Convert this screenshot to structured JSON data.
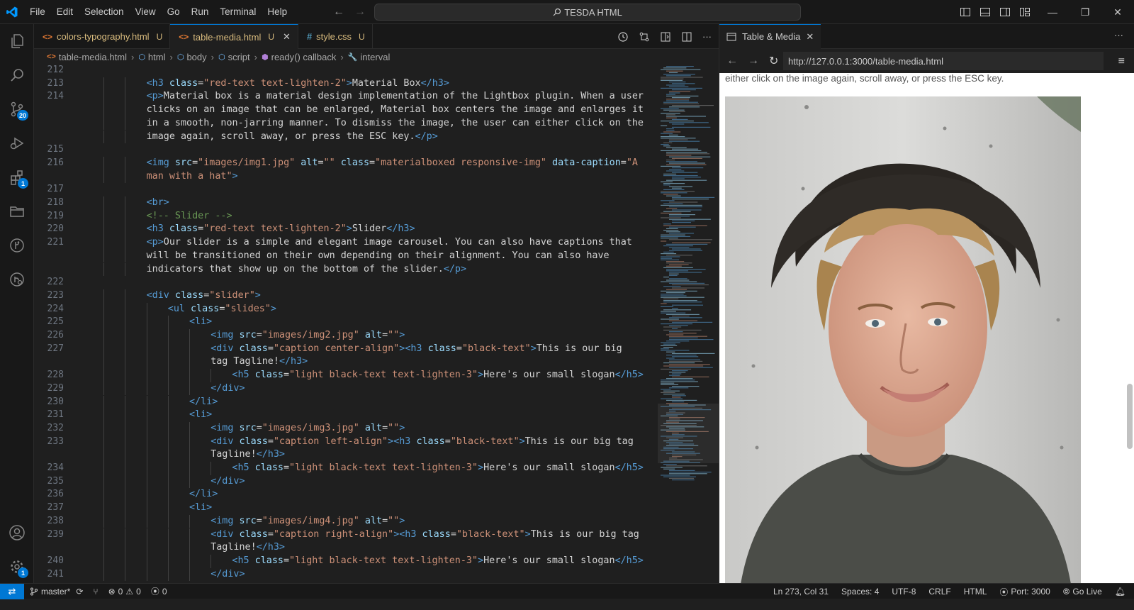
{
  "titlebar": {
    "menu": [
      "File",
      "Edit",
      "Selection",
      "View",
      "Go",
      "Run",
      "Terminal",
      "Help"
    ],
    "command_center": "TESDA HTML"
  },
  "activity_bar": {
    "items": [
      {
        "icon": "files-icon"
      },
      {
        "icon": "search-icon"
      },
      {
        "icon": "source-control-icon",
        "badge": "20"
      },
      {
        "icon": "run-debug-icon"
      },
      {
        "icon": "extensions-icon",
        "badge": "1"
      },
      {
        "icon": "folder-icon"
      },
      {
        "icon": "git-graph-icon"
      },
      {
        "icon": "remote-explorer-icon"
      }
    ],
    "bottom": [
      {
        "icon": "account-icon"
      },
      {
        "icon": "settings-gear-icon",
        "badge": "1"
      }
    ]
  },
  "editor_tabs": [
    {
      "label": "colors-typography.html",
      "modified": "U",
      "icon": "html-icon",
      "active": false
    },
    {
      "label": "table-media.html",
      "modified": "U",
      "icon": "html-icon",
      "active": true
    },
    {
      "label": "style.css",
      "modified": "U",
      "icon": "css-icon",
      "active": false
    }
  ],
  "breadcrumbs": [
    "table-media.html",
    "html",
    "body",
    "script",
    "ready() callback",
    "interval"
  ],
  "code_lines": [
    {
      "n": "212",
      "indent": 0,
      "parts": []
    },
    {
      "n": "213",
      "indent": 3,
      "parts": [
        [
          "t",
          "<h3 "
        ],
        [
          "a",
          "class"
        ],
        [
          "x",
          "="
        ],
        [
          "s",
          "\"red-text text-lighten-2\""
        ],
        [
          "t",
          ">"
        ],
        [
          "x",
          "Material Box"
        ],
        [
          "t",
          "</h3>"
        ]
      ]
    },
    {
      "n": "214",
      "indent": 3,
      "parts": [
        [
          "t",
          "<p>"
        ],
        [
          "x",
          "Material box is a material design implementation of the Lightbox plugin. When a user"
        ]
      ]
    },
    {
      "n": "",
      "indent": 3,
      "parts": [
        [
          "x",
          "clicks on an image that can be enlarged, Material box centers the image and enlarges it"
        ]
      ]
    },
    {
      "n": "",
      "indent": 3,
      "parts": [
        [
          "x",
          "in a smooth, non-jarring manner. To dismiss the image, the user can either click on the"
        ]
      ]
    },
    {
      "n": "",
      "indent": 3,
      "parts": [
        [
          "x",
          "image again, scroll away, or press the ESC key."
        ],
        [
          "t",
          "</p>"
        ]
      ]
    },
    {
      "n": "215",
      "indent": 0,
      "parts": []
    },
    {
      "n": "216",
      "indent": 3,
      "parts": [
        [
          "t",
          "<img "
        ],
        [
          "a",
          "src"
        ],
        [
          "x",
          "="
        ],
        [
          "s",
          "\"images/img1.jpg\""
        ],
        [
          "x",
          " "
        ],
        [
          "a",
          "alt"
        ],
        [
          "x",
          "="
        ],
        [
          "s",
          "\"\""
        ],
        [
          "x",
          " "
        ],
        [
          "a",
          "class"
        ],
        [
          "x",
          "="
        ],
        [
          "s",
          "\"materialboxed responsive-img\""
        ],
        [
          "x",
          " "
        ],
        [
          "a",
          "data-caption"
        ],
        [
          "x",
          "="
        ],
        [
          "s",
          "\"A"
        ]
      ]
    },
    {
      "n": "",
      "indent": 3,
      "parts": [
        [
          "s",
          "man with a hat\""
        ],
        [
          "t",
          ">"
        ]
      ]
    },
    {
      "n": "217",
      "indent": 0,
      "parts": []
    },
    {
      "n": "218",
      "indent": 3,
      "parts": [
        [
          "t",
          "<br>"
        ]
      ]
    },
    {
      "n": "219",
      "indent": 3,
      "parts": [
        [
          "c",
          "<!-- Slider -->"
        ]
      ]
    },
    {
      "n": "220",
      "indent": 3,
      "parts": [
        [
          "t",
          "<h3 "
        ],
        [
          "a",
          "class"
        ],
        [
          "x",
          "="
        ],
        [
          "s",
          "\"red-text text-lighten-2\""
        ],
        [
          "t",
          ">"
        ],
        [
          "x",
          "Slider"
        ],
        [
          "t",
          "</h3>"
        ]
      ]
    },
    {
      "n": "221",
      "indent": 3,
      "parts": [
        [
          "t",
          "<p>"
        ],
        [
          "x",
          "Our slider is a simple and elegant image carousel. You can also have captions that"
        ]
      ]
    },
    {
      "n": "",
      "indent": 3,
      "parts": [
        [
          "x",
          "will be transitioned on their own depending on their alignment. You can also have"
        ]
      ]
    },
    {
      "n": "",
      "indent": 3,
      "parts": [
        [
          "x",
          "indicators that show up on the bottom of the slider."
        ],
        [
          "t",
          "</p>"
        ]
      ]
    },
    {
      "n": "222",
      "indent": 0,
      "parts": []
    },
    {
      "n": "223",
      "indent": 3,
      "parts": [
        [
          "t",
          "<div "
        ],
        [
          "a",
          "class"
        ],
        [
          "x",
          "="
        ],
        [
          "s",
          "\"slider\""
        ],
        [
          "t",
          ">"
        ]
      ]
    },
    {
      "n": "224",
      "indent": 4,
      "parts": [
        [
          "t",
          "<ul "
        ],
        [
          "a",
          "class"
        ],
        [
          "x",
          "="
        ],
        [
          "s",
          "\"slides\""
        ],
        [
          "t",
          ">"
        ]
      ]
    },
    {
      "n": "225",
      "indent": 5,
      "parts": [
        [
          "t",
          "<li>"
        ]
      ]
    },
    {
      "n": "226",
      "indent": 6,
      "parts": [
        [
          "t",
          "<img "
        ],
        [
          "a",
          "src"
        ],
        [
          "x",
          "="
        ],
        [
          "s",
          "\"images/img2.jpg\""
        ],
        [
          "x",
          " "
        ],
        [
          "a",
          "alt"
        ],
        [
          "x",
          "="
        ],
        [
          "s",
          "\"\""
        ],
        [
          "t",
          ">"
        ]
      ]
    },
    {
      "n": "227",
      "indent": 6,
      "parts": [
        [
          "t",
          "<div "
        ],
        [
          "a",
          "class"
        ],
        [
          "x",
          "="
        ],
        [
          "s",
          "\"caption center-align\""
        ],
        [
          "t",
          ">"
        ],
        [
          "t",
          "<h3 "
        ],
        [
          "a",
          "class"
        ],
        [
          "x",
          "="
        ],
        [
          "s",
          "\"black-text\""
        ],
        [
          "t",
          ">"
        ],
        [
          "x",
          "This is our big"
        ]
      ]
    },
    {
      "n": "",
      "indent": 6,
      "parts": [
        [
          "x",
          "tag Tagline!"
        ],
        [
          "t",
          "</h3>"
        ]
      ]
    },
    {
      "n": "228",
      "indent": 7,
      "parts": [
        [
          "t",
          "<h5 "
        ],
        [
          "a",
          "class"
        ],
        [
          "x",
          "="
        ],
        [
          "s",
          "\"light black-text text-lighten-3\""
        ],
        [
          "t",
          ">"
        ],
        [
          "x",
          "Here's our small slogan"
        ],
        [
          "t",
          "</h5>"
        ]
      ]
    },
    {
      "n": "229",
      "indent": 6,
      "parts": [
        [
          "t",
          "</div>"
        ]
      ]
    },
    {
      "n": "230",
      "indent": 5,
      "parts": [
        [
          "t",
          "</li>"
        ]
      ]
    },
    {
      "n": "231",
      "indent": 5,
      "parts": [
        [
          "t",
          "<li>"
        ]
      ]
    },
    {
      "n": "232",
      "indent": 6,
      "parts": [
        [
          "t",
          "<img "
        ],
        [
          "a",
          "src"
        ],
        [
          "x",
          "="
        ],
        [
          "s",
          "\"images/img3.jpg\""
        ],
        [
          "x",
          " "
        ],
        [
          "a",
          "alt"
        ],
        [
          "x",
          "="
        ],
        [
          "s",
          "\"\""
        ],
        [
          "t",
          ">"
        ]
      ]
    },
    {
      "n": "233",
      "indent": 6,
      "parts": [
        [
          "t",
          "<div "
        ],
        [
          "a",
          "class"
        ],
        [
          "x",
          "="
        ],
        [
          "s",
          "\"caption left-align\""
        ],
        [
          "t",
          ">"
        ],
        [
          "t",
          "<h3 "
        ],
        [
          "a",
          "class"
        ],
        [
          "x",
          "="
        ],
        [
          "s",
          "\"black-text\""
        ],
        [
          "t",
          ">"
        ],
        [
          "x",
          "This is our big tag"
        ]
      ]
    },
    {
      "n": "",
      "indent": 6,
      "parts": [
        [
          "x",
          "Tagline!"
        ],
        [
          "t",
          "</h3>"
        ]
      ]
    },
    {
      "n": "234",
      "indent": 7,
      "parts": [
        [
          "t",
          "<h5 "
        ],
        [
          "a",
          "class"
        ],
        [
          "x",
          "="
        ],
        [
          "s",
          "\"light black-text text-lighten-3\""
        ],
        [
          "t",
          ">"
        ],
        [
          "x",
          "Here's our small slogan"
        ],
        [
          "t",
          "</h5>"
        ]
      ]
    },
    {
      "n": "235",
      "indent": 6,
      "parts": [
        [
          "t",
          "</div>"
        ]
      ]
    },
    {
      "n": "236",
      "indent": 5,
      "parts": [
        [
          "t",
          "</li>"
        ]
      ]
    },
    {
      "n": "237",
      "indent": 5,
      "parts": [
        [
          "t",
          "<li>"
        ]
      ]
    },
    {
      "n": "238",
      "indent": 6,
      "parts": [
        [
          "t",
          "<img "
        ],
        [
          "a",
          "src"
        ],
        [
          "x",
          "="
        ],
        [
          "s",
          "\"images/img4.jpg\""
        ],
        [
          "x",
          " "
        ],
        [
          "a",
          "alt"
        ],
        [
          "x",
          "="
        ],
        [
          "s",
          "\"\""
        ],
        [
          "t",
          ">"
        ]
      ]
    },
    {
      "n": "239",
      "indent": 6,
      "parts": [
        [
          "t",
          "<div "
        ],
        [
          "a",
          "class"
        ],
        [
          "x",
          "="
        ],
        [
          "s",
          "\"caption right-align\""
        ],
        [
          "t",
          ">"
        ],
        [
          "t",
          "<h3 "
        ],
        [
          "a",
          "class"
        ],
        [
          "x",
          "="
        ],
        [
          "s",
          "\"black-text\""
        ],
        [
          "t",
          ">"
        ],
        [
          "x",
          "This is our big tag"
        ]
      ]
    },
    {
      "n": "",
      "indent": 6,
      "parts": [
        [
          "x",
          "Tagline!"
        ],
        [
          "t",
          "</h3>"
        ]
      ]
    },
    {
      "n": "240",
      "indent": 7,
      "parts": [
        [
          "t",
          "<h5 "
        ],
        [
          "a",
          "class"
        ],
        [
          "x",
          "="
        ],
        [
          "s",
          "\"light black-text text-lighten-3\""
        ],
        [
          "t",
          ">"
        ],
        [
          "x",
          "Here's our small slogan"
        ],
        [
          "t",
          "</h5>"
        ]
      ]
    },
    {
      "n": "241",
      "indent": 6,
      "parts": [
        [
          "t",
          "</div>"
        ]
      ]
    }
  ],
  "browser": {
    "tab_label": "Table & Media",
    "url": "http://127.0.0.1:3000/table-media.html",
    "page_text": "either click on the image again, scroll away, or press the ESC key."
  },
  "statusbar": {
    "branch": "master*",
    "errors": "0",
    "warnings": "0",
    "ports": "0",
    "position": "Ln 273, Col 31",
    "spaces": "Spaces: 4",
    "encoding": "UTF-8",
    "eol": "CRLF",
    "language": "HTML",
    "port": "Port: 3000",
    "go_live": "Go Live"
  },
  "colors": {
    "accent": "#0078d4",
    "tag": "#569cd6",
    "attribute": "#9cdcfe",
    "string": "#ce9178",
    "comment": "#6a9955"
  }
}
